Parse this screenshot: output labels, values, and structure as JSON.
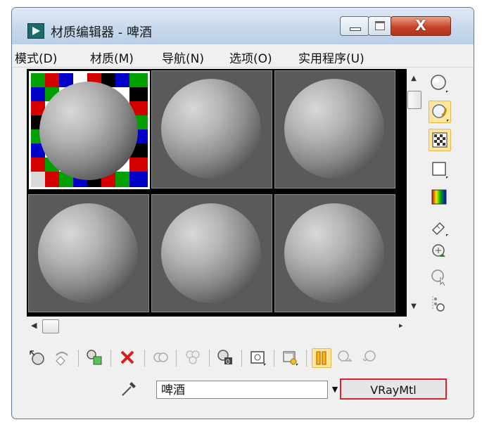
{
  "window": {
    "title": "材质编辑器 - 啤酒",
    "minimize_glyph": "",
    "maximize_glyph": "",
    "close_glyph": "X"
  },
  "menu": [
    "模式(D)",
    "材质(M)",
    "导航(N)",
    "选项(O)",
    "实用程序(U)"
  ],
  "material": {
    "name": "啤酒",
    "type": "VRayMtl"
  },
  "colors": {
    "highlight_border": "#d9232a",
    "active_tool_bg": "#ffe69a",
    "slot_bg": "#5a5a5a"
  },
  "icons": {
    "right_toolbar": [
      "sample-type-sphere-icon",
      "backlight-icon",
      "background-checker-icon",
      "sample-uv-tiling-icon",
      "video-color-check-icon",
      "make-preview-icon",
      "options-icon",
      "select-by-material-icon",
      "material-map-navigator-icon"
    ],
    "bottom_toolbar": [
      "get-material-icon",
      "put-to-scene-icon",
      "assign-to-selection-icon",
      "reset-map-icon",
      "make-unique-icon",
      "put-to-library-icon",
      "material-id-channel-icon",
      "show-map-in-viewport-icon",
      "show-end-result-icon",
      "go-to-parent-icon",
      "go-forward-sibling-icon"
    ]
  }
}
